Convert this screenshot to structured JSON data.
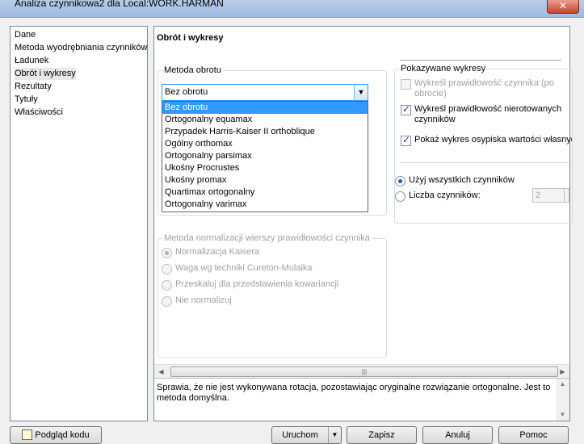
{
  "window": {
    "title": "Analiza czynnikowa2 dla Local:WORK.HARMAN",
    "close_label": "✕"
  },
  "nav": {
    "items": [
      {
        "label": "Dane",
        "selected": false
      },
      {
        "label": "Metoda wyodrębniania czynników",
        "selected": false
      },
      {
        "label": "Ładunek",
        "selected": false
      },
      {
        "label": "Obrót i wykresy",
        "selected": true
      },
      {
        "label": "Rezultaty",
        "selected": false
      },
      {
        "label": "Tytuły",
        "selected": false
      },
      {
        "label": "Właściwości",
        "selected": false
      }
    ]
  },
  "page": {
    "title": "Obrót i wykresy"
  },
  "rotation": {
    "legend": "Metoda obrotu",
    "selected": "Bez obrotu",
    "options": [
      "Bez obrotu",
      "Ortogonalny equamax",
      "Przypadek Harris-Kaiser II orthoblique",
      "Ogólny orthomax",
      "Ortogonalny parsimax",
      "Ukośny Procrustes",
      "Ukośny promax",
      "Quartimax ortogonalny",
      "Ortogonalny varimax"
    ]
  },
  "plots": {
    "legend": "Pokazywane wykresy",
    "checkboxes": [
      {
        "label": "Wykreśl prawidłowość czynnika (po obrocie)",
        "checked": false,
        "disabled": true
      },
      {
        "label": "Wykreśl prawidłowość nierotowanych czynników",
        "checked": true,
        "disabled": false
      },
      {
        "label": "Pokaż wykres osypiska wartości własnyc",
        "checked": true,
        "disabled": false
      }
    ],
    "radios": [
      {
        "label": "Użyj wszystkich czynników",
        "checked": true
      },
      {
        "label": "Liczba czynników:",
        "checked": false
      }
    ],
    "factor_count": "2"
  },
  "normalization": {
    "legend": "Metoda normalizacji wierszy prawidłowości czynnika",
    "options": [
      {
        "label": "Normalizacja Kaisera",
        "checked": true
      },
      {
        "label": "Waga wg techniki Cureton-Mulaika",
        "checked": false
      },
      {
        "label": "Przeskaluj dla przedstawienia kowariancji",
        "checked": false
      },
      {
        "label": "Nie normalizuj",
        "checked": false
      }
    ]
  },
  "description": "Sprawia, że nie jest wykonywana rotacja, pozostawiając oryginalne rozwiązanie ortogonalne. Jest to metoda domyślna.",
  "buttons": {
    "code_preview": "Podgląd kodu",
    "run": "Uruchom",
    "save": "Zapisz",
    "cancel": "Anuluj",
    "help": "Pomoc"
  }
}
